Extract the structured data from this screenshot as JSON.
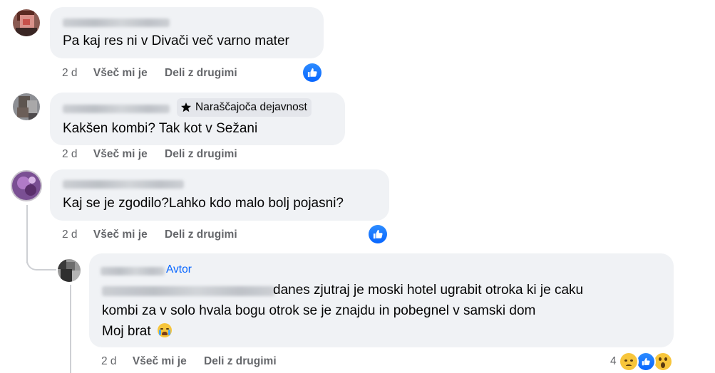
{
  "comments": [
    {
      "text": "Pa kaj res ni v Divači več varno mater",
      "time": "2 d",
      "like": "Všeč mi je",
      "share": "Deli z drugimi"
    },
    {
      "badge": "Naraščajoča dejavnost",
      "text": "Kakšen kombi? Tak kot v Sežani",
      "time": "2 d",
      "like": "Všeč mi je",
      "share": "Deli z drugimi"
    },
    {
      "text": "Kaj se je zgodilo?Lahko kdo malo bolj pojasni?",
      "time": "2 d",
      "like": "Všeč mi je",
      "share": "Deli z drugimi"
    }
  ],
  "reply": {
    "author_label": "Avtor",
    "line1": "danes zjutraj je moski hotel ugrabit otroka ki je caku",
    "line2": "kombi za v solo hvala bogu otrok se je znajdu in pobegnel v samski dom",
    "line3": "Moj brat",
    "time": "2 d",
    "like": "Všeč mi je",
    "share": "Deli z drugimi",
    "reaction_count": "4"
  }
}
